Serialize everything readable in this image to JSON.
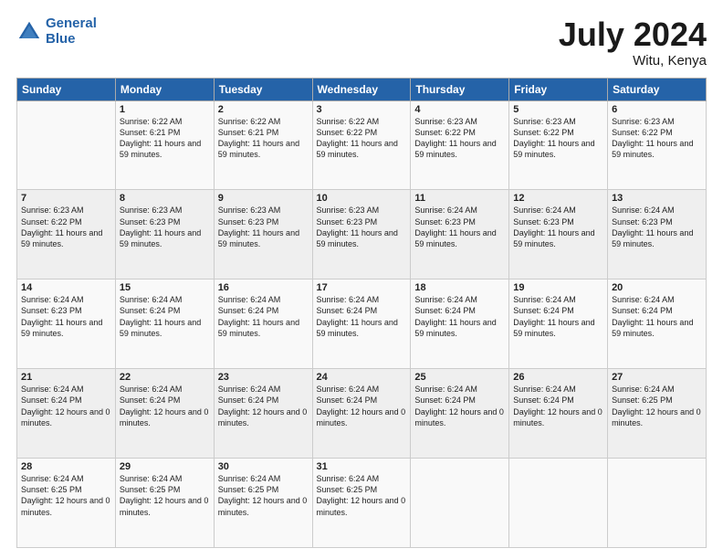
{
  "logo": {
    "text_general": "General",
    "text_blue": "Blue"
  },
  "header": {
    "month_year": "July 2024",
    "location": "Witu, Kenya"
  },
  "weekdays": [
    "Sunday",
    "Monday",
    "Tuesday",
    "Wednesday",
    "Thursday",
    "Friday",
    "Saturday"
  ],
  "weeks": [
    [
      {
        "day": "",
        "sunrise": "",
        "sunset": "",
        "daylight": ""
      },
      {
        "day": "1",
        "sunrise": "Sunrise: 6:22 AM",
        "sunset": "Sunset: 6:21 PM",
        "daylight": "Daylight: 11 hours and 59 minutes."
      },
      {
        "day": "2",
        "sunrise": "Sunrise: 6:22 AM",
        "sunset": "Sunset: 6:21 PM",
        "daylight": "Daylight: 11 hours and 59 minutes."
      },
      {
        "day": "3",
        "sunrise": "Sunrise: 6:22 AM",
        "sunset": "Sunset: 6:22 PM",
        "daylight": "Daylight: 11 hours and 59 minutes."
      },
      {
        "day": "4",
        "sunrise": "Sunrise: 6:23 AM",
        "sunset": "Sunset: 6:22 PM",
        "daylight": "Daylight: 11 hours and 59 minutes."
      },
      {
        "day": "5",
        "sunrise": "Sunrise: 6:23 AM",
        "sunset": "Sunset: 6:22 PM",
        "daylight": "Daylight: 11 hours and 59 minutes."
      },
      {
        "day": "6",
        "sunrise": "Sunrise: 6:23 AM",
        "sunset": "Sunset: 6:22 PM",
        "daylight": "Daylight: 11 hours and 59 minutes."
      }
    ],
    [
      {
        "day": "7",
        "sunrise": "Sunrise: 6:23 AM",
        "sunset": "Sunset: 6:22 PM",
        "daylight": "Daylight: 11 hours and 59 minutes."
      },
      {
        "day": "8",
        "sunrise": "Sunrise: 6:23 AM",
        "sunset": "Sunset: 6:23 PM",
        "daylight": "Daylight: 11 hours and 59 minutes."
      },
      {
        "day": "9",
        "sunrise": "Sunrise: 6:23 AM",
        "sunset": "Sunset: 6:23 PM",
        "daylight": "Daylight: 11 hours and 59 minutes."
      },
      {
        "day": "10",
        "sunrise": "Sunrise: 6:23 AM",
        "sunset": "Sunset: 6:23 PM",
        "daylight": "Daylight: 11 hours and 59 minutes."
      },
      {
        "day": "11",
        "sunrise": "Sunrise: 6:24 AM",
        "sunset": "Sunset: 6:23 PM",
        "daylight": "Daylight: 11 hours and 59 minutes."
      },
      {
        "day": "12",
        "sunrise": "Sunrise: 6:24 AM",
        "sunset": "Sunset: 6:23 PM",
        "daylight": "Daylight: 11 hours and 59 minutes."
      },
      {
        "day": "13",
        "sunrise": "Sunrise: 6:24 AM",
        "sunset": "Sunset: 6:23 PM",
        "daylight": "Daylight: 11 hours and 59 minutes."
      }
    ],
    [
      {
        "day": "14",
        "sunrise": "Sunrise: 6:24 AM",
        "sunset": "Sunset: 6:23 PM",
        "daylight": "Daylight: 11 hours and 59 minutes."
      },
      {
        "day": "15",
        "sunrise": "Sunrise: 6:24 AM",
        "sunset": "Sunset: 6:24 PM",
        "daylight": "Daylight: 11 hours and 59 minutes."
      },
      {
        "day": "16",
        "sunrise": "Sunrise: 6:24 AM",
        "sunset": "Sunset: 6:24 PM",
        "daylight": "Daylight: 11 hours and 59 minutes."
      },
      {
        "day": "17",
        "sunrise": "Sunrise: 6:24 AM",
        "sunset": "Sunset: 6:24 PM",
        "daylight": "Daylight: 11 hours and 59 minutes."
      },
      {
        "day": "18",
        "sunrise": "Sunrise: 6:24 AM",
        "sunset": "Sunset: 6:24 PM",
        "daylight": "Daylight: 11 hours and 59 minutes."
      },
      {
        "day": "19",
        "sunrise": "Sunrise: 6:24 AM",
        "sunset": "Sunset: 6:24 PM",
        "daylight": "Daylight: 11 hours and 59 minutes."
      },
      {
        "day": "20",
        "sunrise": "Sunrise: 6:24 AM",
        "sunset": "Sunset: 6:24 PM",
        "daylight": "Daylight: 11 hours and 59 minutes."
      }
    ],
    [
      {
        "day": "21",
        "sunrise": "Sunrise: 6:24 AM",
        "sunset": "Sunset: 6:24 PM",
        "daylight": "Daylight: 12 hours and 0 minutes."
      },
      {
        "day": "22",
        "sunrise": "Sunrise: 6:24 AM",
        "sunset": "Sunset: 6:24 PM",
        "daylight": "Daylight: 12 hours and 0 minutes."
      },
      {
        "day": "23",
        "sunrise": "Sunrise: 6:24 AM",
        "sunset": "Sunset: 6:24 PM",
        "daylight": "Daylight: 12 hours and 0 minutes."
      },
      {
        "day": "24",
        "sunrise": "Sunrise: 6:24 AM",
        "sunset": "Sunset: 6:24 PM",
        "daylight": "Daylight: 12 hours and 0 minutes."
      },
      {
        "day": "25",
        "sunrise": "Sunrise: 6:24 AM",
        "sunset": "Sunset: 6:24 PM",
        "daylight": "Daylight: 12 hours and 0 minutes."
      },
      {
        "day": "26",
        "sunrise": "Sunrise: 6:24 AM",
        "sunset": "Sunset: 6:24 PM",
        "daylight": "Daylight: 12 hours and 0 minutes."
      },
      {
        "day": "27",
        "sunrise": "Sunrise: 6:24 AM",
        "sunset": "Sunset: 6:25 PM",
        "daylight": "Daylight: 12 hours and 0 minutes."
      }
    ],
    [
      {
        "day": "28",
        "sunrise": "Sunrise: 6:24 AM",
        "sunset": "Sunset: 6:25 PM",
        "daylight": "Daylight: 12 hours and 0 minutes."
      },
      {
        "day": "29",
        "sunrise": "Sunrise: 6:24 AM",
        "sunset": "Sunset: 6:25 PM",
        "daylight": "Daylight: 12 hours and 0 minutes."
      },
      {
        "day": "30",
        "sunrise": "Sunrise: 6:24 AM",
        "sunset": "Sunset: 6:25 PM",
        "daylight": "Daylight: 12 hours and 0 minutes."
      },
      {
        "day": "31",
        "sunrise": "Sunrise: 6:24 AM",
        "sunset": "Sunset: 6:25 PM",
        "daylight": "Daylight: 12 hours and 0 minutes."
      },
      {
        "day": "",
        "sunrise": "",
        "sunset": "",
        "daylight": ""
      },
      {
        "day": "",
        "sunrise": "",
        "sunset": "",
        "daylight": ""
      },
      {
        "day": "",
        "sunrise": "",
        "sunset": "",
        "daylight": ""
      }
    ]
  ]
}
